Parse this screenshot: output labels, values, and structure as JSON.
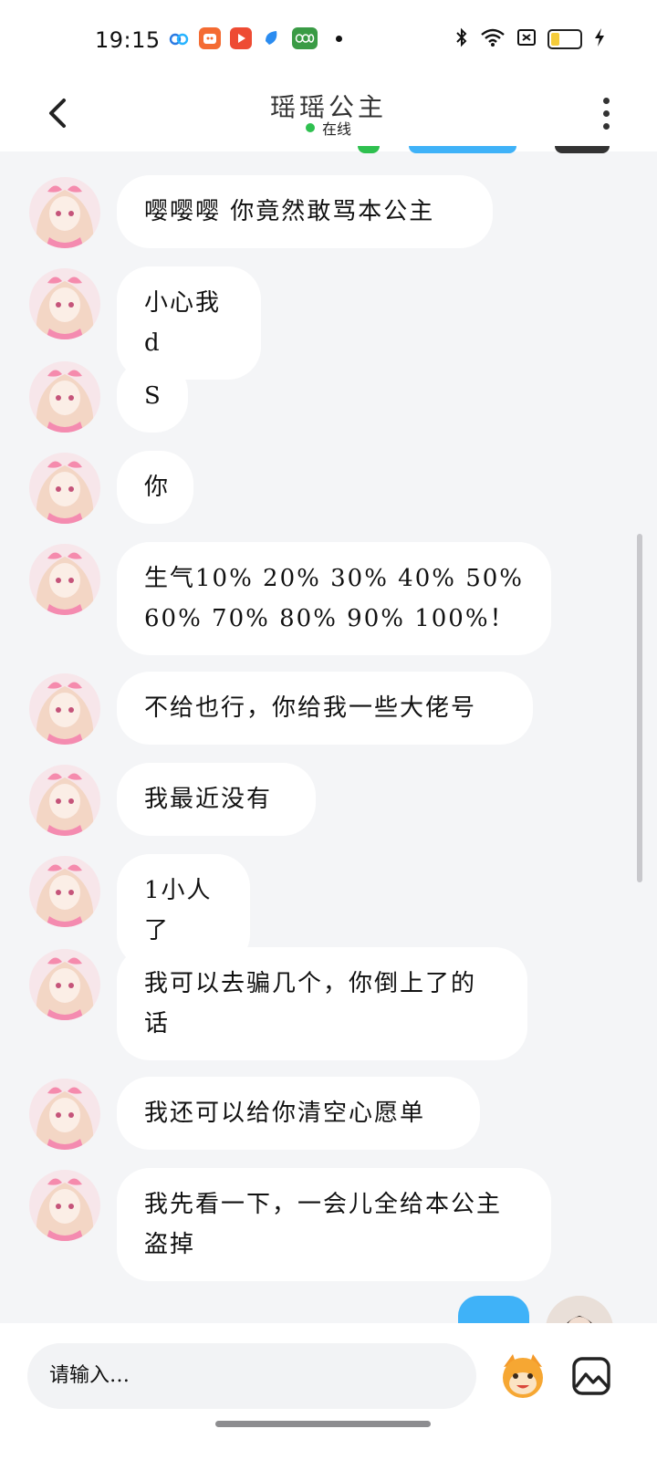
{
  "status_bar": {
    "time": "19:15",
    "app_icons": [
      "cloud-app-icon",
      "video-app-icon",
      "play-app-icon",
      "browser-app-icon",
      "oppo-app-icon"
    ],
    "notification_dot": true,
    "system_icons": [
      "bluetooth-icon",
      "wifi-icon",
      "sim-off-icon",
      "battery-icon",
      "charging-icon"
    ],
    "battery_level": 0.3
  },
  "header": {
    "title": "瑶瑶公主",
    "status_text": "在线",
    "status_color": "#2ec04f"
  },
  "messages": [
    {
      "text": "嘤嘤嘤 你竟然敢骂本公主"
    },
    {
      "text": "小心我d"
    },
    {
      "text": "S"
    },
    {
      "text": "你"
    },
    {
      "text": "生气10% 20% 30% 40% 50% 60% 70% 80% 90% 100%！"
    },
    {
      "text": "不给也行，你给我一些大佬号"
    },
    {
      "text": "我最近没有"
    },
    {
      "text": "1小人了"
    },
    {
      "text": "我可以去骗几个，你倒上了的话"
    },
    {
      "text": "我还可以给你清空心愿单"
    },
    {
      "text": "我先看一下，一会儿全给本公主盗掉"
    }
  ],
  "composer": {
    "placeholder": "请输入…"
  },
  "colors": {
    "background": "#f4f5f7",
    "bubble": "#ffffff",
    "self_bubble": "#3fb2f8",
    "accent_online": "#2ec04f"
  }
}
